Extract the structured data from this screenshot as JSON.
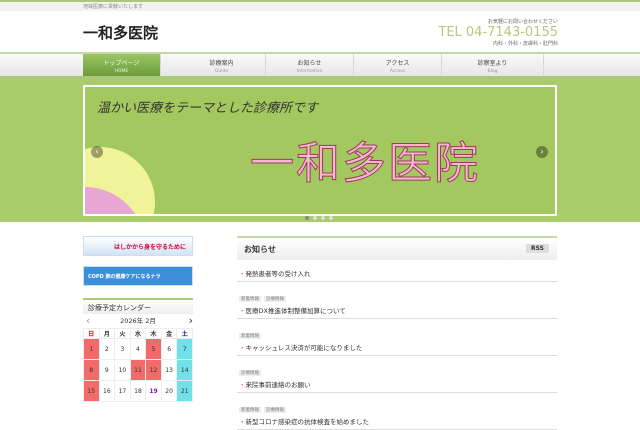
{
  "topbar": "地域医療に貢献いたします",
  "logo": "一和多医院",
  "contact": {
    "small": "お気軽にお問い合わせください",
    "tel": "TEL 04-7143-0155",
    "depts": "内科・外科・皮膚科・肛門科"
  },
  "nav": [
    {
      "label": "トップページ",
      "en": "HOME"
    },
    {
      "label": "診療案内",
      "en": "Guide"
    },
    {
      "label": "お知らせ",
      "en": "Information"
    },
    {
      "label": "アクセス",
      "en": "Access"
    },
    {
      "label": "診察室より",
      "en": "Blog"
    }
  ],
  "hero": {
    "caption": "温かい医療をテーマとした診療所です",
    "title": "一和多医院"
  },
  "banners": {
    "b1": "はしかから身を守るために",
    "b2": "COPD 肺の健康ケアになるナラ"
  },
  "calendar": {
    "title": "診療予定カレンダー",
    "month": "2026年 2月",
    "weekdays": [
      "日",
      "月",
      "火",
      "水",
      "木",
      "金",
      "土"
    ],
    "rows": [
      [
        "1",
        "2",
        "3",
        "4",
        "5",
        "6",
        "7"
      ],
      [
        "8",
        "9",
        "10",
        "11",
        "12",
        "13",
        "14"
      ],
      [
        "15",
        "16",
        "17",
        "18",
        "19",
        "20",
        "21"
      ]
    ]
  },
  "news": {
    "title": "お知らせ",
    "rss": "RSS",
    "items": [
      {
        "tags": [],
        "title": "発熱患者等の受け入れ"
      },
      {
        "tags": [
          "新着情報",
          "診療情報"
        ],
        "title": "医療DX推進体制整備加算について"
      },
      {
        "tags": [
          "新着情報"
        ],
        "title": "キャッシュレス決済が可能になりました"
      },
      {
        "tags": [
          "診療情報"
        ],
        "title": "来院事前連絡のお願い"
      },
      {
        "tags": [
          "新着情報",
          "診療情報"
        ],
        "title": "新型コロナ感染症の抗体検査を始めました"
      }
    ]
  }
}
